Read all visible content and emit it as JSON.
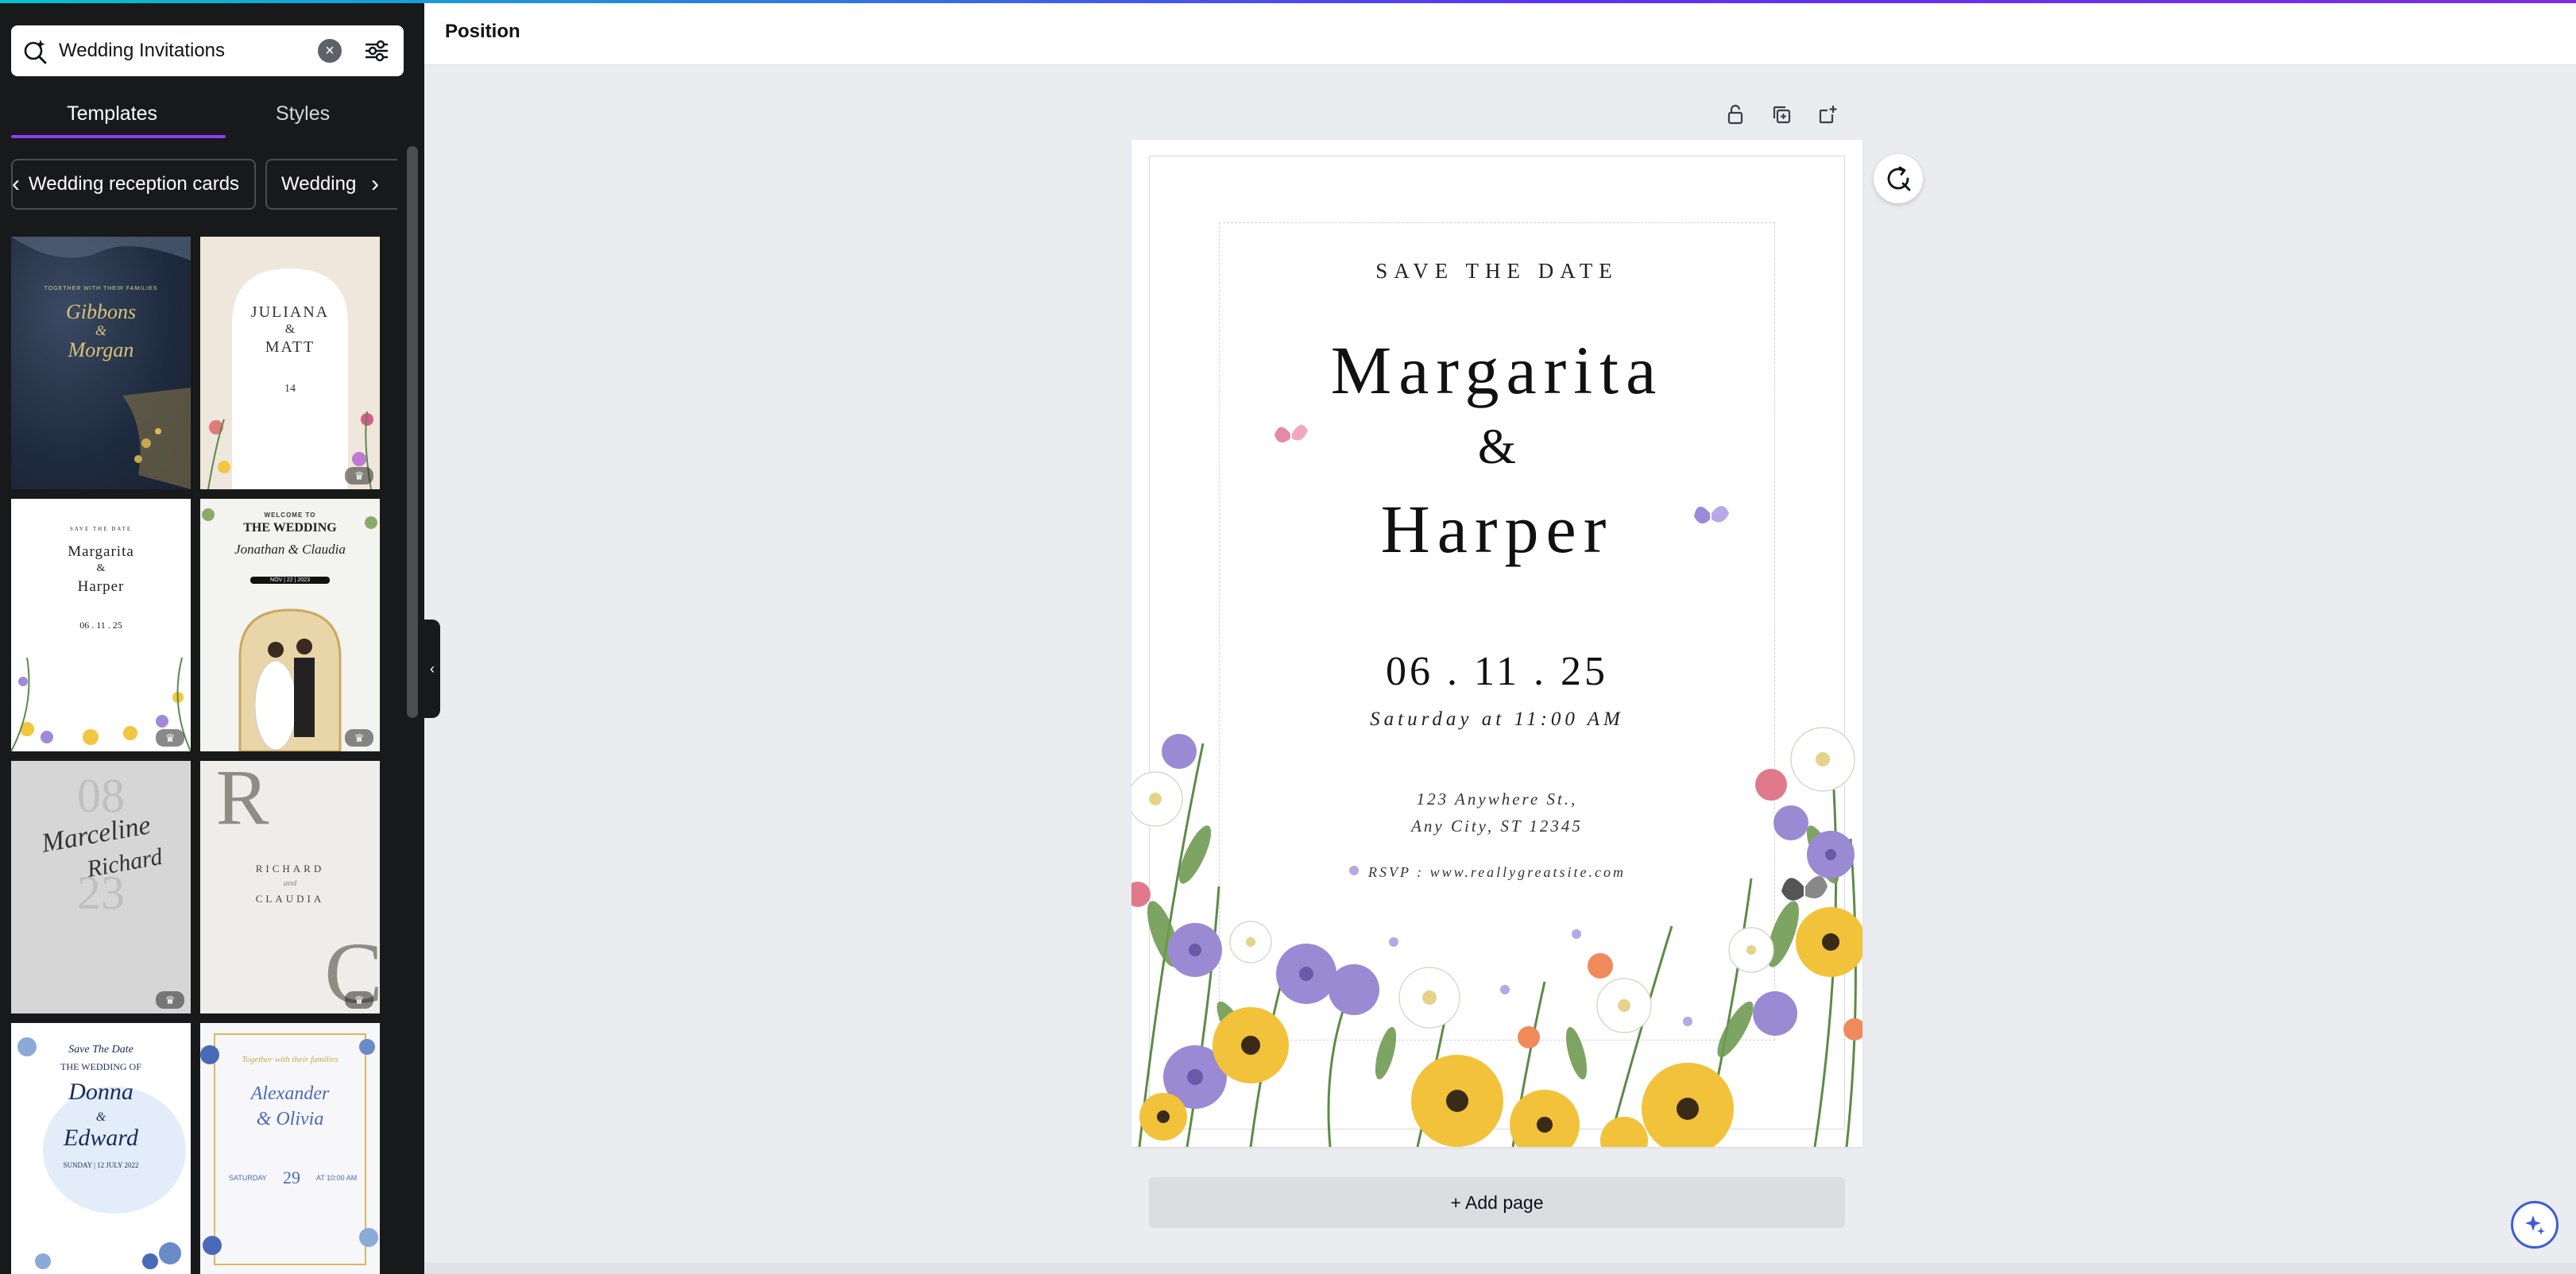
{
  "search": {
    "query": "Wedding Invitations"
  },
  "tabs": [
    {
      "label": "Templates"
    },
    {
      "label": "Styles"
    }
  ],
  "chips": [
    {
      "label": "Wedding reception cards"
    },
    {
      "label": "Wedding r"
    }
  ],
  "templates": [
    {
      "name": "Gibbons & Morgan",
      "lines": [
        "TOGETHER WITH THEIR FAMILIES",
        "Gibbons",
        "&",
        "Morgan"
      ],
      "premium": false
    },
    {
      "name": "Juliana & Matt",
      "lines": [
        "JULIANA",
        "&",
        "MATT",
        "14"
      ],
      "premium": true
    },
    {
      "name": "Margarita & Harper",
      "lines": [
        "SAVE THE DATE",
        "Margarita",
        "&",
        "Harper",
        "06 . 11 . 25"
      ],
      "premium": true
    },
    {
      "name": "Jonathan & Claudia",
      "lines": [
        "WELCOME TO",
        "THE WEDDING",
        "Jonathan & Claudia",
        "NOV | 22 | 2023"
      ],
      "premium": true
    },
    {
      "name": "Marceline & Richard",
      "lines": [
        "08",
        "23",
        "Marceline",
        "Richard"
      ],
      "premium": true
    },
    {
      "name": "Richard & Claudia",
      "lines": [
        "R",
        "RICHARD",
        "and",
        "CLAUDIA",
        "C"
      ],
      "premium": true
    },
    {
      "name": "Donna & Edward",
      "lines": [
        "Save The Date",
        "THE WEDDING OF",
        "Donna",
        "&",
        "Edward",
        "SUNDAY | 12 JULY 2022"
      ],
      "premium": false
    },
    {
      "name": "Alexander & Olivia",
      "lines": [
        "Together with their families",
        "Alexander",
        "& Olivia",
        "SATURDAY",
        "29",
        "AT 10:00 AM"
      ],
      "premium": false
    }
  ],
  "topbar": {
    "label": "Position"
  },
  "page": {
    "save_the_date": "SAVE THE DATE",
    "name1": "Margarita",
    "amp": "&",
    "name2": "Harper",
    "date": "06 . 11 . 25",
    "time": "Saturday at 11:00 AM",
    "address1": "123 Anywhere St.,",
    "address2": "Any City, ST 12345",
    "rsvp": "RSVP : www.reallygreatsite.com"
  },
  "add_page": {
    "label": "+ Add page"
  },
  "colors": {
    "accent": "#8b3dff",
    "panel": "#18191b",
    "canvas": "#ebecf0"
  },
  "icons": [
    "magic-search-icon",
    "clear-icon",
    "filter-icon",
    "lock-icon",
    "duplicate-icon",
    "add-page-icon",
    "refresh-icon",
    "magic-icon",
    "crown-icon"
  ]
}
